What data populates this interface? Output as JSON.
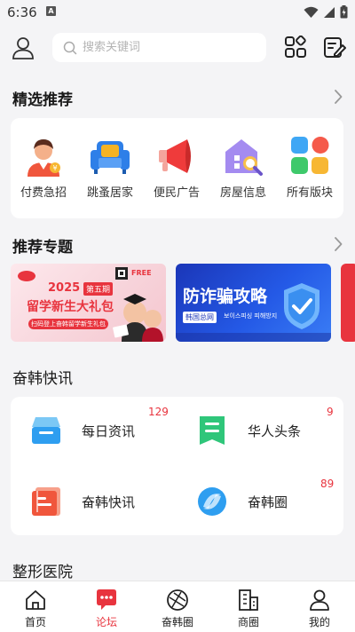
{
  "status_bar": {
    "time": "6:36",
    "notification_letter": "A"
  },
  "header": {
    "search_placeholder": "搜索关键词"
  },
  "featured": {
    "title": "精选推荐",
    "items": [
      {
        "label": "付费急招",
        "icon": "worker-avatar-icon"
      },
      {
        "label": "跳蚤居家",
        "icon": "sofa-icon"
      },
      {
        "label": "便民广告",
        "icon": "megaphone-icon"
      },
      {
        "label": "房屋信息",
        "icon": "house-search-icon"
      },
      {
        "label": "所有版块",
        "icon": "all-sections-grid-icon"
      }
    ]
  },
  "topics": {
    "title": "推荐专题",
    "banners": [
      {
        "year": "2025",
        "issue": "第五期",
        "headline": "留学新生大礼包",
        "tag": "FREE",
        "sub": "扫码登上奋韩留学新生礼包"
      },
      {
        "headline": "防诈骗攻略",
        "tag": "韩国总网",
        "sub": "보이스피싱 피해방지"
      }
    ]
  },
  "quick_news": {
    "title": "奋韩快讯",
    "items": [
      {
        "label": "每日资讯",
        "count": "129",
        "icon": "inbox-tray-icon"
      },
      {
        "label": "华人头条",
        "count": "9",
        "icon": "headline-doc-icon"
      },
      {
        "label": "奋韩快讯",
        "count": "",
        "icon": "news-doc-icon"
      },
      {
        "label": "奋韩圈",
        "count": "89",
        "icon": "circle-swirl-icon"
      }
    ]
  },
  "next_section": {
    "title": "整形医院"
  },
  "bottom_nav": {
    "items": [
      {
        "label": "首页",
        "icon": "home-icon",
        "active": false
      },
      {
        "label": "论坛",
        "icon": "forum-chat-icon",
        "active": true
      },
      {
        "label": "奋韩圈",
        "icon": "aperture-icon",
        "active": false
      },
      {
        "label": "商圈",
        "icon": "building-icon",
        "active": false
      },
      {
        "label": "我的",
        "icon": "user-icon",
        "active": false
      }
    ]
  },
  "colors": {
    "accent": "#e8343e",
    "background": "#f4f4f6",
    "card": "#ffffff"
  }
}
